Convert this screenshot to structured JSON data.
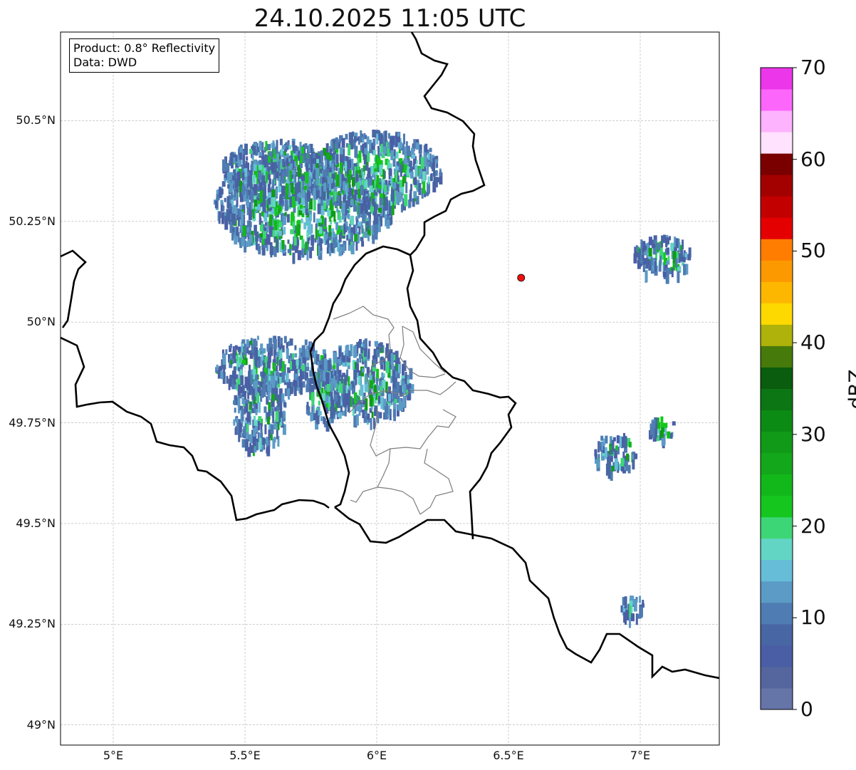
{
  "title": "24.10.2025 11:05 UTC",
  "info": {
    "product": "Product: 0.8° Reflectivity",
    "source": "Data: DWD"
  },
  "axes": {
    "lon_range": [
      4.8,
      7.3
    ],
    "lat_range": [
      48.95,
      50.72
    ],
    "x_ticks": [
      {
        "value": 5.0,
        "label": "5°E"
      },
      {
        "value": 5.5,
        "label": "5.5°E"
      },
      {
        "value": 6.0,
        "label": "6°E"
      },
      {
        "value": 6.5,
        "label": "6.5°E"
      },
      {
        "value": 7.0,
        "label": "7°E"
      }
    ],
    "y_ticks": [
      {
        "value": 50.5,
        "label": "50.5°N"
      },
      {
        "value": 50.25,
        "label": "50.25°N"
      },
      {
        "value": 50.0,
        "label": "50°N"
      },
      {
        "value": 49.75,
        "label": "49.75°N"
      },
      {
        "value": 49.5,
        "label": "49.5°N"
      },
      {
        "value": 49.25,
        "label": "49.25°N"
      },
      {
        "value": 49.0,
        "label": "49°N"
      }
    ],
    "grid": true
  },
  "radar_site": {
    "lon": 6.548,
    "lat": 50.11,
    "color": "#ee1111"
  },
  "colorbar": {
    "label": "dBZ",
    "min": 0,
    "max": 70,
    "tick_labels": [
      "0",
      "10",
      "20",
      "30",
      "40",
      "50",
      "60",
      "70"
    ],
    "colors": [
      "#6675a8",
      "#55659e",
      "#4a5ea5",
      "#4866a3",
      "#4f7cb2",
      "#5b9bc6",
      "#66bdd8",
      "#62d5c5",
      "#3dd676",
      "#14c61e",
      "#12b81a",
      "#13a71b",
      "#119a17",
      "#0c8b14",
      "#0b7613",
      "#0a5c0e",
      "#467a0a",
      "#aeb20a",
      "#fed900",
      "#fdb700",
      "#fd9900",
      "#ff7d00",
      "#e40000",
      "#c30000",
      "#a30000",
      "#7a0000",
      "#ffe2fe",
      "#feb3fe",
      "#fd66fb",
      "#eb36ea"
    ]
  },
  "echoes": [
    {
      "lon": 5.72,
      "lat": 50.3,
      "rlon": 0.34,
      "rlat": 0.13,
      "strength": 0.85
    },
    {
      "lon": 5.98,
      "lat": 50.38,
      "rlon": 0.26,
      "rlat": 0.1,
      "strength": 0.8
    },
    {
      "lon": 5.62,
      "lat": 50.38,
      "rlon": 0.22,
      "rlat": 0.08,
      "strength": 0.55
    },
    {
      "lon": 5.95,
      "lat": 49.86,
      "rlon": 0.18,
      "rlat": 0.1,
      "strength": 0.75
    },
    {
      "lon": 5.6,
      "lat": 49.9,
      "rlon": 0.22,
      "rlat": 0.07,
      "strength": 0.45
    },
    {
      "lon": 5.55,
      "lat": 49.78,
      "rlon": 0.1,
      "rlat": 0.1,
      "strength": 0.4
    },
    {
      "lon": 5.8,
      "lat": 49.83,
      "rlon": 0.08,
      "rlat": 0.08,
      "strength": 0.6
    },
    {
      "lon": 6.9,
      "lat": 49.68,
      "rlon": 0.08,
      "rlat": 0.05,
      "strength": 0.55
    },
    {
      "lon": 7.08,
      "lat": 49.74,
      "rlon": 0.05,
      "rlat": 0.03,
      "strength": 0.6
    },
    {
      "lon": 7.08,
      "lat": 50.17,
      "rlon": 0.12,
      "rlat": 0.05,
      "strength": 0.45
    },
    {
      "lon": 6.96,
      "lat": 49.3,
      "rlon": 0.05,
      "rlat": 0.03,
      "strength": 0.25
    }
  ]
}
